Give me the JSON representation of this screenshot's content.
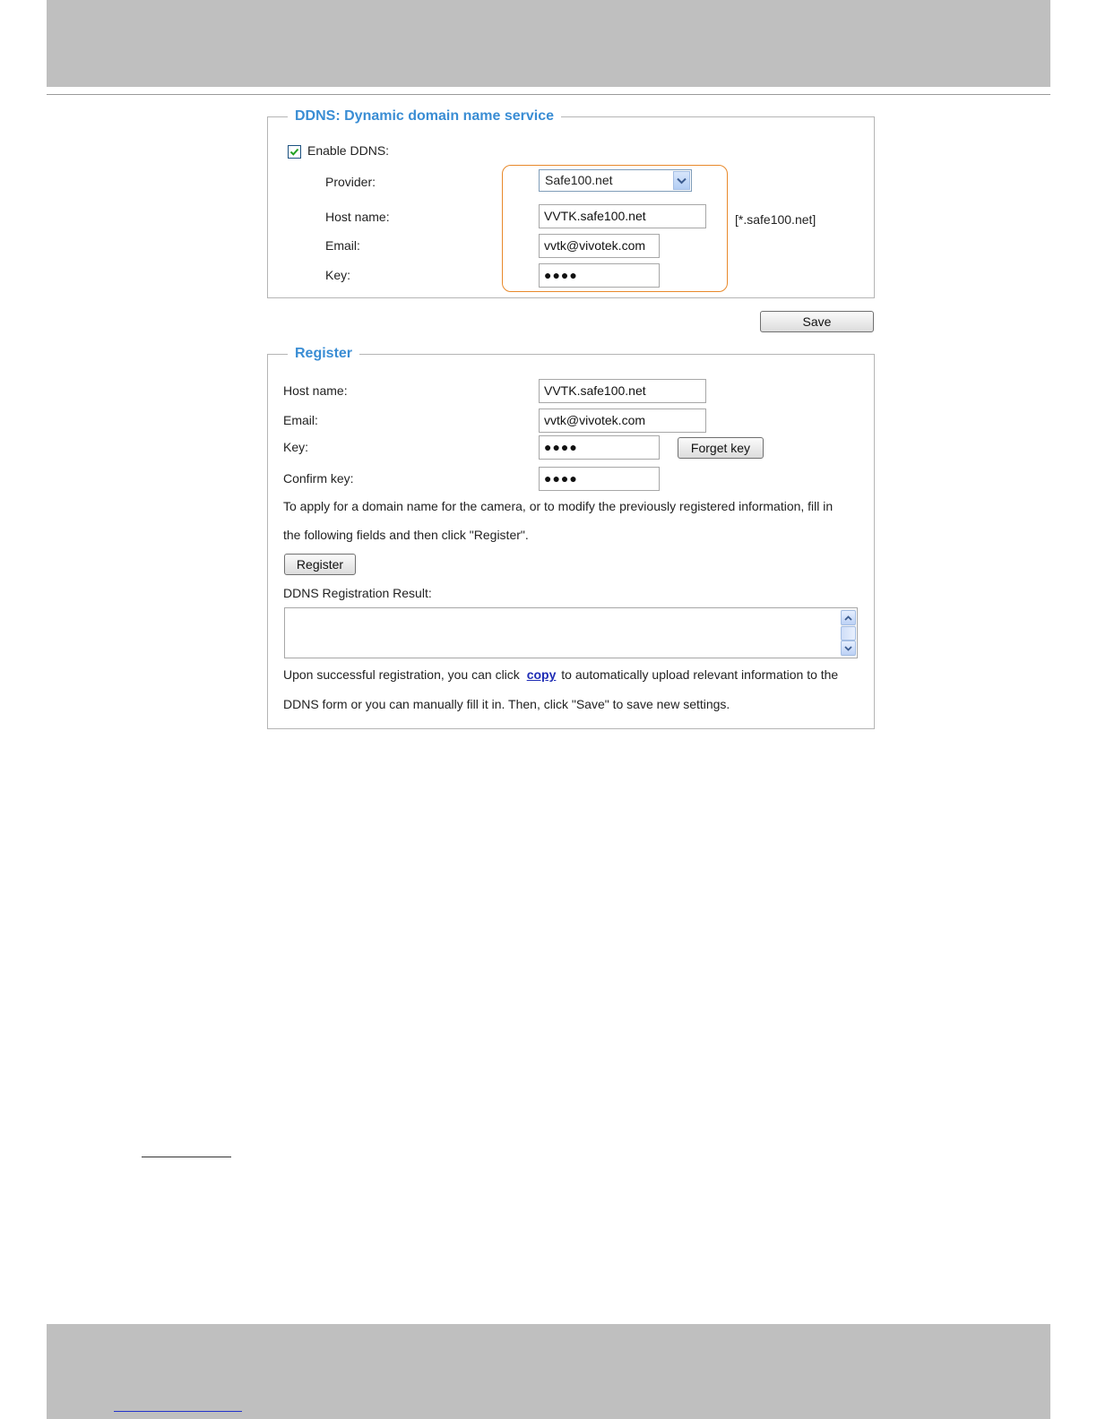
{
  "ddns": {
    "legend": "DDNS: Dynamic domain name service",
    "enable_label": "Enable DDNS:",
    "enabled": true,
    "provider_label": "Provider:",
    "provider_value": "Safe100.net",
    "host_label": "Host name:",
    "host_value": "VVTK.safe100.net",
    "host_suffix": "[*.safe100.net]",
    "email_label": "Email:",
    "email_value": "vvtk@vivotek.com",
    "key_label": "Key:",
    "key_value": "●●●●",
    "save_label": "Save",
    "highlight_color": "#e8892b"
  },
  "register": {
    "legend": "Register",
    "host_label": "Host name:",
    "host_value": "VVTK.safe100.net",
    "email_label": "Email:",
    "email_value": "vvtk@vivotek.com",
    "key_label": "Key:",
    "key_value": "●●●●",
    "forget_key_label": "Forget key",
    "confirm_label": "Confirm key:",
    "confirm_value": "●●●●",
    "instructions_line1": "To apply for a domain name for the camera, or to modify the previously registered information, fill in",
    "instructions_line2": "the following fields and then click \"Register\".",
    "register_label": "Register",
    "result_label": "DDNS Registration Result:",
    "note_before": "Upon successful registration, you can click",
    "copy_label": "copy",
    "note_after": "to automatically upload relevant information to the",
    "note_line2": "DDNS form or you can manually fill it in. Then, click \"Save\" to save new settings."
  },
  "colors": {
    "legend": "#3a8dd4",
    "link": "#1f2db5",
    "band": "#bfbfbf"
  }
}
